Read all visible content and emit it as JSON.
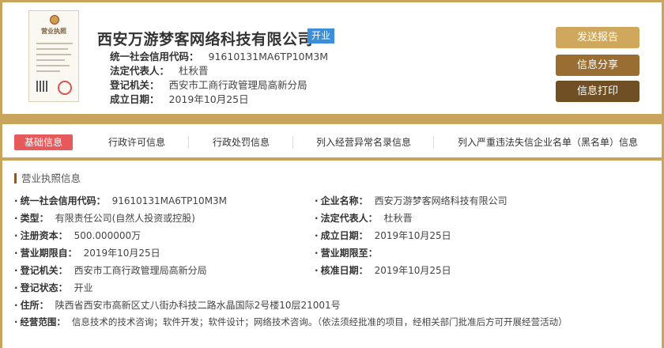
{
  "company": {
    "name": "西安万游梦客网络科技有限公司",
    "status": "开业",
    "info": [
      {
        "label": "统一社会信用代码：",
        "value": "91610131MA6TP10M3M"
      },
      {
        "label": "法定代表人：",
        "value": "杜秋晋"
      },
      {
        "label": "登记机关：",
        "value": "西安市工商行政管理局高新分局"
      },
      {
        "label": "成立日期：",
        "value": "2019年10月25日"
      }
    ]
  },
  "license_image": {
    "title": "营业执照",
    "icon": "business-license-image"
  },
  "actions": {
    "report": "发送报告",
    "share": "信息分享",
    "print": "信息打印"
  },
  "tabs": [
    {
      "label": "基础信息",
      "active": true
    },
    {
      "label": "行政许可信息",
      "active": false
    },
    {
      "label": "行政处罚信息",
      "active": false
    },
    {
      "label": "列入经营异常名录信息",
      "active": false
    },
    {
      "label": "列入严重违法失信企业名单（黑名单）信息",
      "active": false
    }
  ],
  "detail": {
    "section_title": "营业执照信息",
    "fields": [
      {
        "label": "统一社会信用代码：",
        "value": "91610131MA6TP10M3M"
      },
      {
        "label": "企业名称：",
        "value": "西安万游梦客网络科技有限公司"
      },
      {
        "label": "类型：",
        "value": "有限责任公司(自然人投资或控股)"
      },
      {
        "label": "法定代表人：",
        "value": "杜秋晋"
      },
      {
        "label": "注册资本：",
        "value": "500.000000万"
      },
      {
        "label": "成立日期：",
        "value": "2019年10月25日"
      },
      {
        "label": "营业期限自：",
        "value": "2019年10月25日"
      },
      {
        "label": "营业期限至：",
        "value": ""
      },
      {
        "label": "登记机关：",
        "value": "西安市工商行政管理局高新分局"
      },
      {
        "label": "核准日期：",
        "value": "2019年10月25日"
      },
      {
        "label": "登记状态：",
        "value": "开业"
      },
      {
        "label": "住所：",
        "value": "陕西省西安市高新区丈八街办科技二路水晶国际2号楼10层21001号"
      },
      {
        "label": "经营范围：",
        "value": "信息技术的技术咨询；软件开发；软件设计；网络技术咨询。（依法须经批准的项目，经相关部门批准后方可开展经营活动）"
      }
    ]
  },
  "colors": {
    "frame": "#c9a45c",
    "badge": "#3b8ed8",
    "tab_active": "#e8595b",
    "btn_report": "#cfa75d",
    "btn_share": "#9a6e33",
    "btn_print": "#6f4f23"
  }
}
